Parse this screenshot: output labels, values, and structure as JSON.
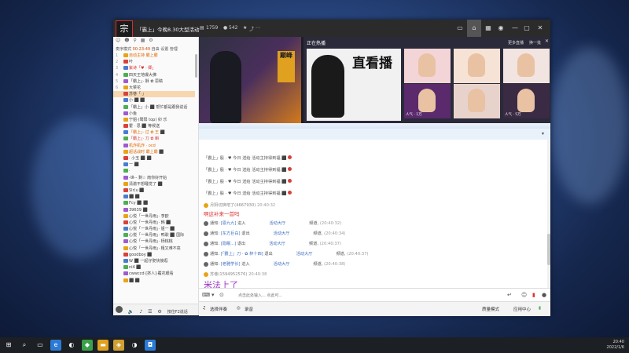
{
  "window": {
    "room_title": "「霸上」今晚8.30大型活动",
    "fans_count": "1759",
    "online_count": "542",
    "buttons": [
      "video-icon",
      "home-icon",
      "list-icon",
      "gamepad-icon",
      "minimize-icon",
      "restore-icon",
      "close-icon"
    ]
  },
  "left_panel": {
    "icons": [
      "person-icon",
      "person-add-icon",
      "location-icon",
      "grid-icon",
      "settings-icon"
    ],
    "status_label": "麦序模式",
    "status_time": "00:23:49",
    "status_tabs": [
      "自由",
      "设置",
      "管理"
    ],
    "users": [
      {
        "num": "1",
        "text": "自动主持 霸上霸",
        "style": "orange"
      },
      {
        "num": "2",
        "text": "叶",
        "style": ""
      },
      {
        "num": "3",
        "text": "紫诗「♥ · 卿」",
        "style": "red"
      },
      {
        "num": "4",
        "text": "四天王地爆大佛",
        "style": ""
      },
      {
        "num": "5",
        "text": "「霸上」· 酥 ✿ 思睛",
        "style": ""
      },
      {
        "num": "6",
        "text": "大菜花",
        "style": ""
      },
      {
        "num": "",
        "text": "苏巷「·」",
        "style": "sel"
      },
      {
        "num": "",
        "text": "小 ⬛ ⬛",
        "style": ""
      },
      {
        "num": "",
        "text": "「霸上」小 ⬛ 帮忙都是跟我说话",
        "style": ""
      },
      {
        "num": "",
        "text": "小鱼",
        "style": ""
      },
      {
        "num": "",
        "text": "宁姐·(鹭阳 top) 卯 乐",
        "style": ""
      },
      {
        "num": "",
        "text": "霍 · 思 ⬛ 等候送",
        "style": ""
      },
      {
        "num": "",
        "text": "「霸上」· 过 ✿ 王 ⬛",
        "style": "orange"
      },
      {
        "num": "",
        "text": "「霸上」· 刀 ✿ 蝌",
        "style": "red"
      },
      {
        "num": "",
        "text": "机炸机炸 · ocd",
        "style": "orange"
      },
      {
        "num": "",
        "text": "超话战时 霸上霸 ⬛",
        "style": "orange"
      },
      {
        "num": "",
        "text": "· 小玉 ⬛ ⬛",
        "style": ""
      },
      {
        "num": "",
        "text": "一 ⬛",
        "style": ""
      },
      {
        "num": "",
        "text": "·",
        "style": ""
      },
      {
        "num": "",
        "text": "-世-- 剩☆ 南你好开始",
        "style": ""
      },
      {
        "num": "",
        "text": "清澈不想睡觉了 ⬛",
        "style": ""
      },
      {
        "num": "",
        "text": "Slr(u ⬛",
        "style": ""
      },
      {
        "num": "",
        "text": "⬛ ⬛",
        "style": ""
      },
      {
        "num": "",
        "text": "Fcy ⬛ ⬛",
        "style": ""
      },
      {
        "num": "",
        "text": "39639 ⬛",
        "style": ""
      },
      {
        "num": "",
        "text": "心悦「一世丹雨」· 李欧",
        "style": ""
      },
      {
        "num": "",
        "text": "心悦「一世丹雨」· 韩 ⬛",
        "style": ""
      },
      {
        "num": "",
        "text": "心悦「一世丹雨」· 姐一 ⬛",
        "style": ""
      },
      {
        "num": "",
        "text": "心悦「一世丹雨」· 鸭歌 ⬛ 国际",
        "style": ""
      },
      {
        "num": "",
        "text": "心悦「一世丹雨」· 杨桃桃",
        "style": ""
      },
      {
        "num": "",
        "text": "心悦「一世丹雨」· 粗又难不高",
        "style": ""
      },
      {
        "num": "",
        "text": "goodboy ⬛",
        "style": ""
      },
      {
        "num": "",
        "text": "W ⬛ 一起仔娶快接逛",
        "style": ""
      },
      {
        "num": "",
        "text": "ni4 ⬛",
        "style": ""
      },
      {
        "num": "",
        "text": "cwwccd·[挤人]·覆花眼看",
        "style": ""
      },
      {
        "num": "",
        "text": "⬛ ⬛",
        "style": ""
      }
    ],
    "bottom_buttons": [
      "volume-icon",
      "mic-icon",
      "equalizer-icon",
      "settings-icon"
    ],
    "bottom_label": "按住F2说话"
  },
  "banner": {
    "game_badge": "巅峰",
    "live_header": "正在热播",
    "more_label": "更多直播",
    "swap_label": "换一批",
    "main_title": "直看播",
    "thumbs": [
      {
        "caption": "",
        "bg": "#f3d5d8"
      },
      {
        "caption": "",
        "bg": "#f7e2d6"
      },
      {
        "caption": "",
        "bg": "#f2e4e0"
      },
      {
        "caption": "人气 · 1万",
        "bg": "#5a2a6c"
      },
      {
        "caption": "",
        "bg": "#e8d3cc"
      },
      {
        "caption": "人气 · 5万",
        "bg": "#3a2a44"
      }
    ]
  },
  "chat": {
    "lines": [
      {
        "kind": "sys",
        "text": "「霸上」殷 · ♥ 今日 送给 活动主持得到福 ⬛"
      },
      {
        "kind": "sys",
        "text": "「霸上」殷 · ♥ 今日 送给 活动主持得到福 ⬛"
      },
      {
        "kind": "sys",
        "text": "「霸上」殷 · ♥ 今日 送给 活动主持得到福 ⬛"
      },
      {
        "kind": "sys",
        "text": "「霸上」殷 · ♥ 今日 送给 活动主持得到福 ⬛"
      },
      {
        "kind": "user",
        "name": "月阳切换吧了(4667930)",
        "time": "20:40:32"
      },
      {
        "kind": "big-red",
        "text": "啊这补来一首吗"
      },
      {
        "kind": "notice",
        "name": "[恩九九]",
        "action": "进入",
        "extra": "活动大厅",
        "time": "(20:40:32)"
      },
      {
        "kind": "notice",
        "name": "[东方巨白]",
        "action": "退出",
        "extra": "活动大厅",
        "time": "(20:40:34)"
      },
      {
        "kind": "notice",
        "name": "[隐眠...]",
        "action": "退出",
        "extra": "活动大厅",
        "time": "(20:40:37)"
      },
      {
        "kind": "notice",
        "name": "[「霸上」刀 · ✿ 林十四]",
        "action": "退出",
        "extra": "活动大厅",
        "time": "(20:40:37)"
      },
      {
        "kind": "notice",
        "name": "[老雅学长]",
        "action": "进入",
        "extra": "活动大厅",
        "time": "(20:40:38)"
      },
      {
        "kind": "user",
        "name": "苏巷(1594952576)",
        "time": "20:40:38"
      },
      {
        "kind": "big-purple",
        "text": "米法上了"
      },
      {
        "kind": "notice",
        "name": "[赛梦 · 不是以前人]",
        "action": "进入",
        "extra": "活动大厅",
        "time": "(20:40:38)"
      }
    ],
    "notice_prefix": "通知:",
    "notice_suffix": "频道,"
  },
  "input": {
    "placeholder": "点击此处输入... 点此可..."
  },
  "bottom": {
    "left_label": "选择伴奏",
    "mid_label": "录音",
    "right_label1": "质量模式",
    "right_label2": "应用中心"
  },
  "taskbar": {
    "time": "20:40",
    "date": "2022/1/6"
  }
}
